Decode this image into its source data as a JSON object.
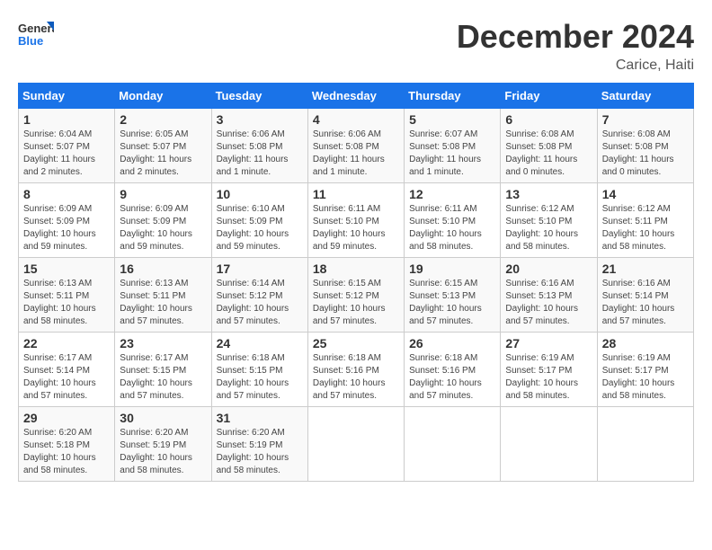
{
  "header": {
    "logo_general": "General",
    "logo_blue": "Blue",
    "month_title": "December 2024",
    "location": "Carice, Haiti"
  },
  "calendar": {
    "days_of_week": [
      "Sunday",
      "Monday",
      "Tuesday",
      "Wednesday",
      "Thursday",
      "Friday",
      "Saturday"
    ],
    "weeks": [
      [
        null,
        null,
        null,
        null,
        null,
        null,
        null
      ]
    ],
    "cells": [
      {
        "day": "",
        "info": ""
      },
      {
        "day": "",
        "info": ""
      },
      {
        "day": "",
        "info": ""
      },
      {
        "day": "",
        "info": ""
      },
      {
        "day": "",
        "info": ""
      },
      {
        "day": "",
        "info": ""
      },
      {
        "day": "",
        "info": ""
      }
    ]
  },
  "weeks": [
    [
      {
        "day": "1",
        "sunrise": "6:04 AM",
        "sunset": "5:07 PM",
        "daylight": "11 hours and 2 minutes."
      },
      {
        "day": "2",
        "sunrise": "6:05 AM",
        "sunset": "5:07 PM",
        "daylight": "11 hours and 2 minutes."
      },
      {
        "day": "3",
        "sunrise": "6:06 AM",
        "sunset": "5:08 PM",
        "daylight": "11 hours and 1 minute."
      },
      {
        "day": "4",
        "sunrise": "6:06 AM",
        "sunset": "5:08 PM",
        "daylight": "11 hours and 1 minute."
      },
      {
        "day": "5",
        "sunrise": "6:07 AM",
        "sunset": "5:08 PM",
        "daylight": "11 hours and 1 minute."
      },
      {
        "day": "6",
        "sunrise": "6:08 AM",
        "sunset": "5:08 PM",
        "daylight": "11 hours and 0 minutes."
      },
      {
        "day": "7",
        "sunrise": "6:08 AM",
        "sunset": "5:08 PM",
        "daylight": "11 hours and 0 minutes."
      }
    ],
    [
      {
        "day": "8",
        "sunrise": "6:09 AM",
        "sunset": "5:09 PM",
        "daylight": "10 hours and 59 minutes."
      },
      {
        "day": "9",
        "sunrise": "6:09 AM",
        "sunset": "5:09 PM",
        "daylight": "10 hours and 59 minutes."
      },
      {
        "day": "10",
        "sunrise": "6:10 AM",
        "sunset": "5:09 PM",
        "daylight": "10 hours and 59 minutes."
      },
      {
        "day": "11",
        "sunrise": "6:11 AM",
        "sunset": "5:10 PM",
        "daylight": "10 hours and 59 minutes."
      },
      {
        "day": "12",
        "sunrise": "6:11 AM",
        "sunset": "5:10 PM",
        "daylight": "10 hours and 58 minutes."
      },
      {
        "day": "13",
        "sunrise": "6:12 AM",
        "sunset": "5:10 PM",
        "daylight": "10 hours and 58 minutes."
      },
      {
        "day": "14",
        "sunrise": "6:12 AM",
        "sunset": "5:11 PM",
        "daylight": "10 hours and 58 minutes."
      }
    ],
    [
      {
        "day": "15",
        "sunrise": "6:13 AM",
        "sunset": "5:11 PM",
        "daylight": "10 hours and 58 minutes."
      },
      {
        "day": "16",
        "sunrise": "6:13 AM",
        "sunset": "5:11 PM",
        "daylight": "10 hours and 57 minutes."
      },
      {
        "day": "17",
        "sunrise": "6:14 AM",
        "sunset": "5:12 PM",
        "daylight": "10 hours and 57 minutes."
      },
      {
        "day": "18",
        "sunrise": "6:15 AM",
        "sunset": "5:12 PM",
        "daylight": "10 hours and 57 minutes."
      },
      {
        "day": "19",
        "sunrise": "6:15 AM",
        "sunset": "5:13 PM",
        "daylight": "10 hours and 57 minutes."
      },
      {
        "day": "20",
        "sunrise": "6:16 AM",
        "sunset": "5:13 PM",
        "daylight": "10 hours and 57 minutes."
      },
      {
        "day": "21",
        "sunrise": "6:16 AM",
        "sunset": "5:14 PM",
        "daylight": "10 hours and 57 minutes."
      }
    ],
    [
      {
        "day": "22",
        "sunrise": "6:17 AM",
        "sunset": "5:14 PM",
        "daylight": "10 hours and 57 minutes."
      },
      {
        "day": "23",
        "sunrise": "6:17 AM",
        "sunset": "5:15 PM",
        "daylight": "10 hours and 57 minutes."
      },
      {
        "day": "24",
        "sunrise": "6:18 AM",
        "sunset": "5:15 PM",
        "daylight": "10 hours and 57 minutes."
      },
      {
        "day": "25",
        "sunrise": "6:18 AM",
        "sunset": "5:16 PM",
        "daylight": "10 hours and 57 minutes."
      },
      {
        "day": "26",
        "sunrise": "6:18 AM",
        "sunset": "5:16 PM",
        "daylight": "10 hours and 57 minutes."
      },
      {
        "day": "27",
        "sunrise": "6:19 AM",
        "sunset": "5:17 PM",
        "daylight": "10 hours and 58 minutes."
      },
      {
        "day": "28",
        "sunrise": "6:19 AM",
        "sunset": "5:17 PM",
        "daylight": "10 hours and 58 minutes."
      }
    ],
    [
      {
        "day": "29",
        "sunrise": "6:20 AM",
        "sunset": "5:18 PM",
        "daylight": "10 hours and 58 minutes."
      },
      {
        "day": "30",
        "sunrise": "6:20 AM",
        "sunset": "5:19 PM",
        "daylight": "10 hours and 58 minutes."
      },
      {
        "day": "31",
        "sunrise": "6:20 AM",
        "sunset": "5:19 PM",
        "daylight": "10 hours and 58 minutes."
      },
      null,
      null,
      null,
      null
    ]
  ],
  "labels": {
    "sunrise": "Sunrise:",
    "sunset": "Sunset:",
    "daylight": "Daylight:"
  }
}
